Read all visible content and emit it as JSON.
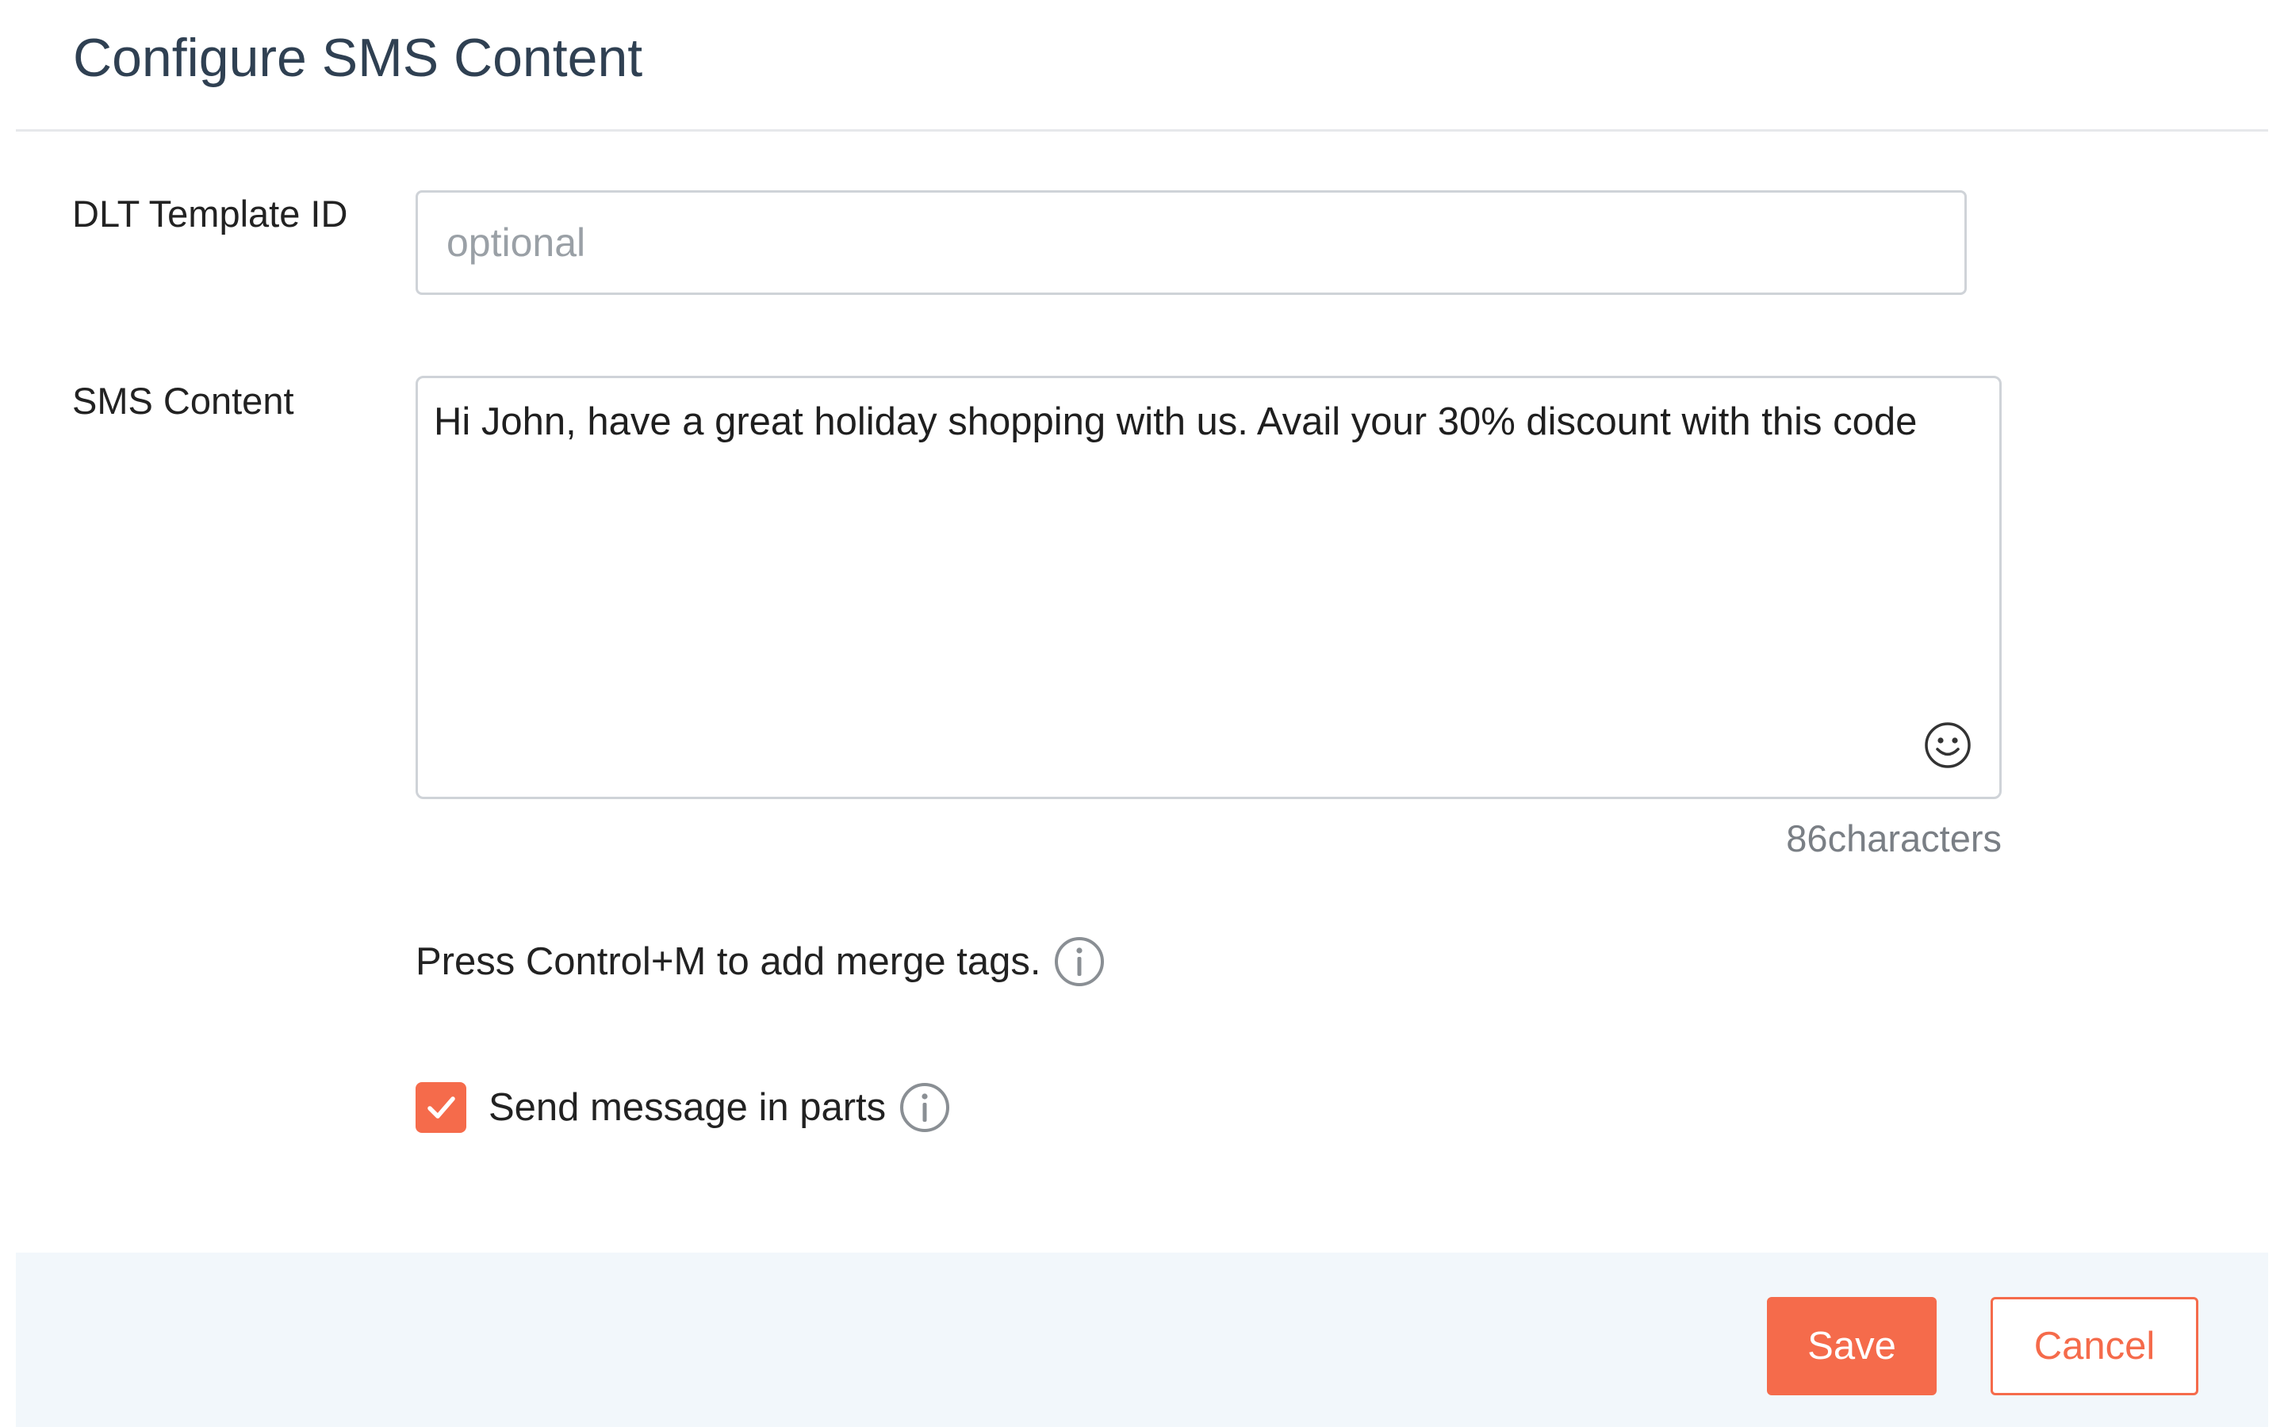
{
  "dialog": {
    "title": "Configure SMS Content"
  },
  "dlt_template": {
    "label": "DLT Template ID",
    "value": "",
    "placeholder": "optional"
  },
  "sms_content": {
    "label": "SMS Content",
    "value": "Hi John, have a great holiday shopping with us. Avail your 30% discount with this code",
    "char_count": "86characters",
    "emoji_icon": "smiley-icon"
  },
  "merge_tags": {
    "hint": "Press Control+M to add merge tags.",
    "info_icon": "info-icon"
  },
  "send_in_parts": {
    "label": "Send message in parts",
    "checked": true,
    "info_icon": "info-icon"
  },
  "footer": {
    "save_label": "Save",
    "cancel_label": "Cancel"
  },
  "colors": {
    "accent": "#f56b4b",
    "title": "#2f4052",
    "footer_bg": "#f2f7fb",
    "border": "#cfd3d8"
  }
}
